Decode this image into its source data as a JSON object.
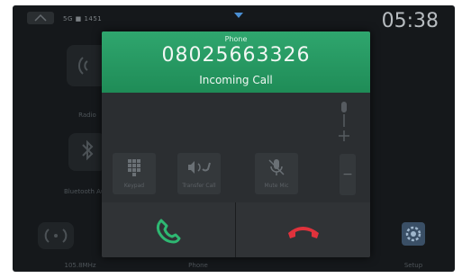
{
  "status": {
    "indicators": "5G ■ 1451",
    "clock": "05:38"
  },
  "background": {
    "tiles": [
      {
        "label": "Radio"
      },
      {
        "label": "Bluetooth Audio"
      },
      {
        "label": "Phone"
      },
      {
        "label": "Setup"
      }
    ],
    "frequency": "105.8MHz"
  },
  "dialog": {
    "title": "Phone",
    "number": "08025663326",
    "status": "Incoming Call"
  },
  "controls": [
    {
      "label": "Keypad",
      "icon": "keypad-icon"
    },
    {
      "label": "Transfer Call",
      "icon": "transfer-call-icon"
    },
    {
      "label": "Mute Mic",
      "icon": "mute-mic-icon"
    }
  ],
  "volume": {
    "plus": "+",
    "minus": "−"
  },
  "call_actions": {
    "answer_icon": "phone-answer-icon",
    "decline_icon": "phone-decline-icon",
    "answer_color": "#2eb872",
    "decline_color": "#e0323c"
  },
  "colors": {
    "header_green": "#22985f",
    "screen_bg": "#15181b"
  }
}
